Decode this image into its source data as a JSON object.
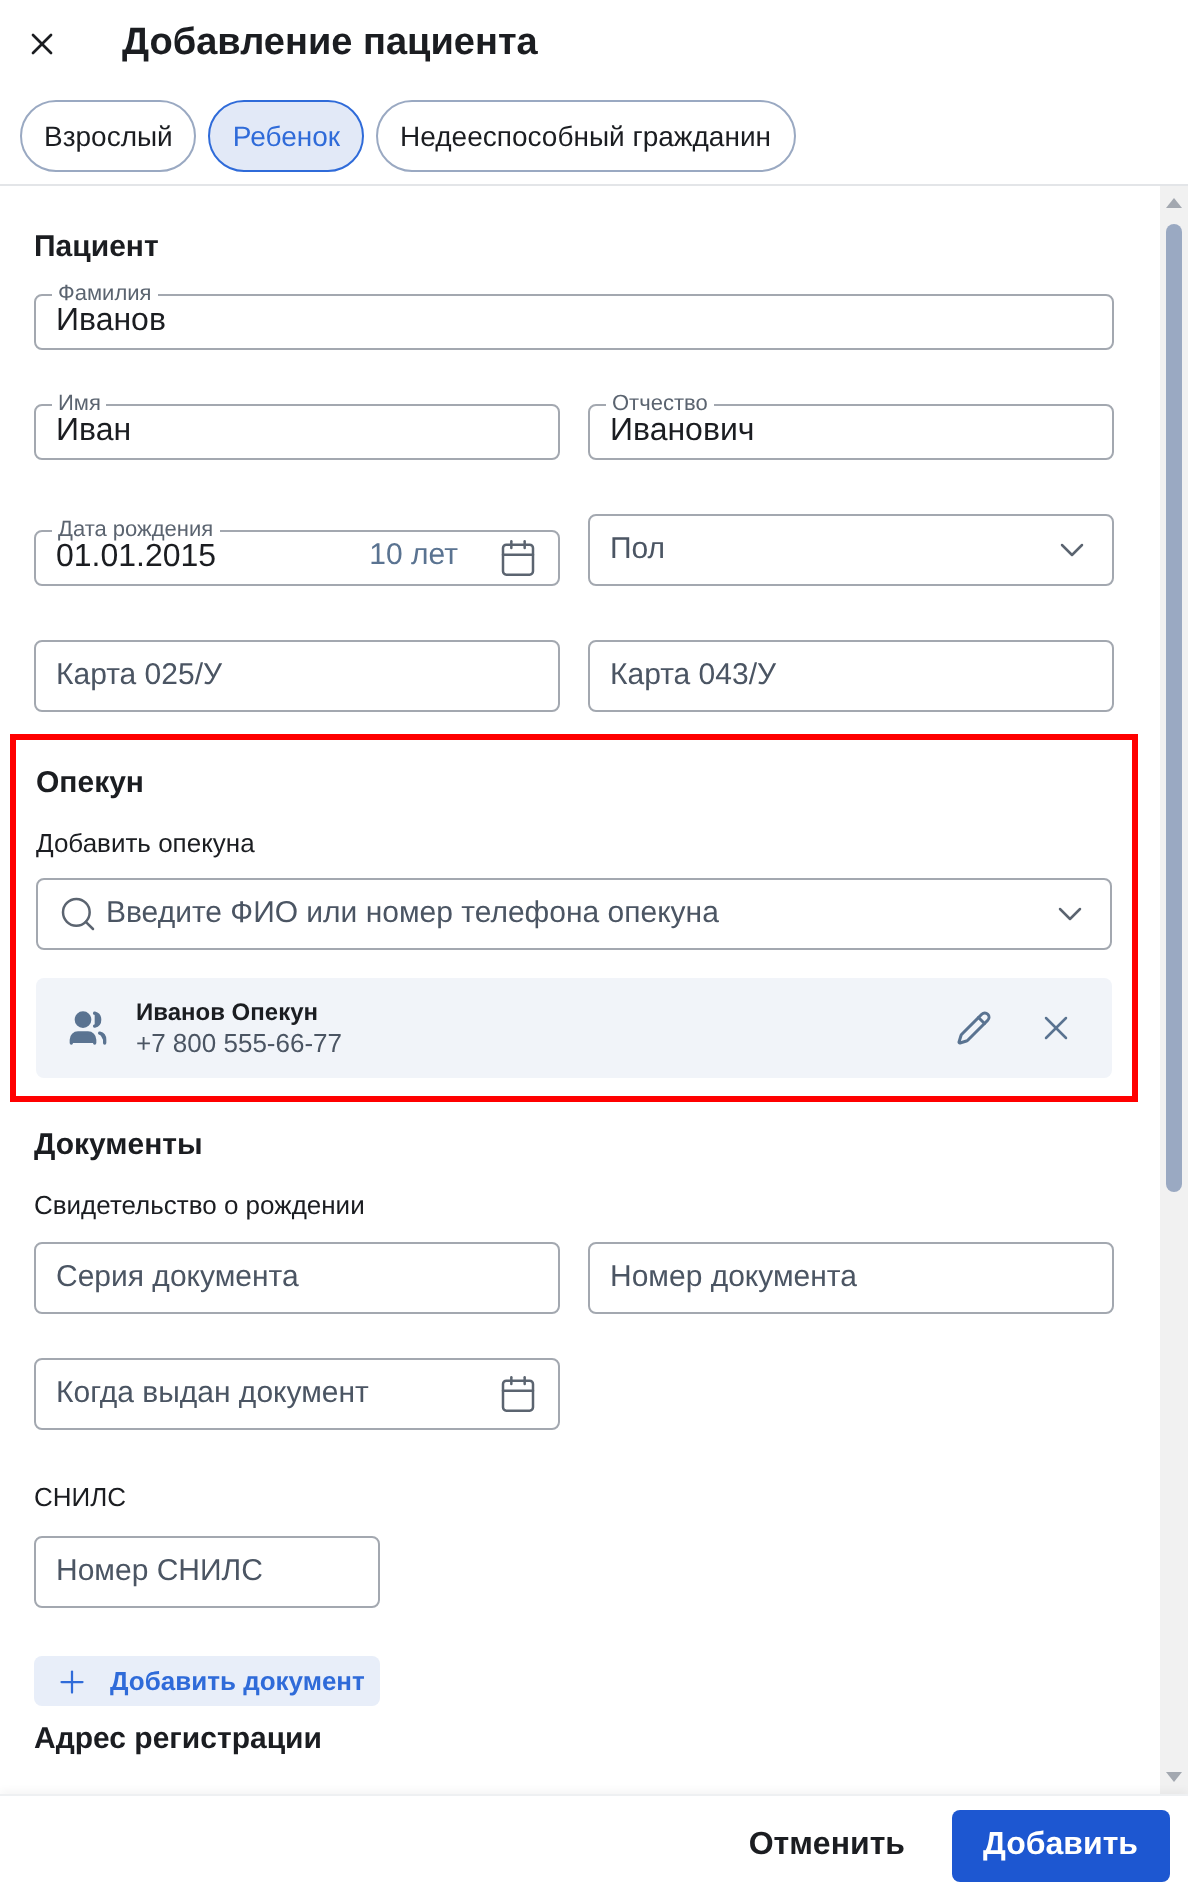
{
  "window": {
    "title": "Добавление пациента"
  },
  "tabs": [
    {
      "label": "Взрослый",
      "selected": false
    },
    {
      "label": "Ребенок",
      "selected": true
    },
    {
      "label": "Недееспособный гражданин",
      "selected": false
    }
  ],
  "patient": {
    "heading": "Пациент",
    "rows": [
      [
        {
          "kind": "text",
          "label": "Фамилия",
          "value": "Иванов"
        }
      ],
      [
        {
          "kind": "text",
          "label": "Имя",
          "value": "Иван"
        },
        {
          "kind": "text",
          "label": "Отчество",
          "value": "Иванович"
        }
      ],
      [
        {
          "kind": "date",
          "label": "Дата рождения",
          "value": "01.01.2015",
          "hint": "10 лет"
        },
        {
          "kind": "select",
          "placeholder": "Пол"
        }
      ],
      [
        {
          "kind": "text",
          "placeholder": "Карта 025/У"
        },
        {
          "kind": "text",
          "placeholder": "Карта 043/У"
        }
      ]
    ]
  },
  "guardian": {
    "highlighted": true,
    "heading": "Опекун",
    "label": "Добавить опекуна",
    "search": {
      "placeholder": "Введите ФИО или номер телефона опекуна"
    },
    "card": {
      "name": "Иванов Опекун",
      "phone": "+7 800 555-66-77"
    }
  },
  "documents": {
    "heading": "Документы",
    "subheading": "Свидетельство о рождении",
    "rows": [
      [
        {
          "kind": "text",
          "placeholder": "Серия документа"
        },
        {
          "kind": "text",
          "placeholder": "Номер документа"
        }
      ],
      [
        {
          "kind": "date",
          "placeholder": "Когда выдан документ"
        }
      ]
    ],
    "snils_label": "СНИЛС",
    "snils": {
      "placeholder": "Номер СНИЛС"
    },
    "add_button": "Добавить документ"
  },
  "next_heading": "Адрес регистрации",
  "footer": {
    "cancel": "Отменить",
    "submit": "Добавить"
  }
}
